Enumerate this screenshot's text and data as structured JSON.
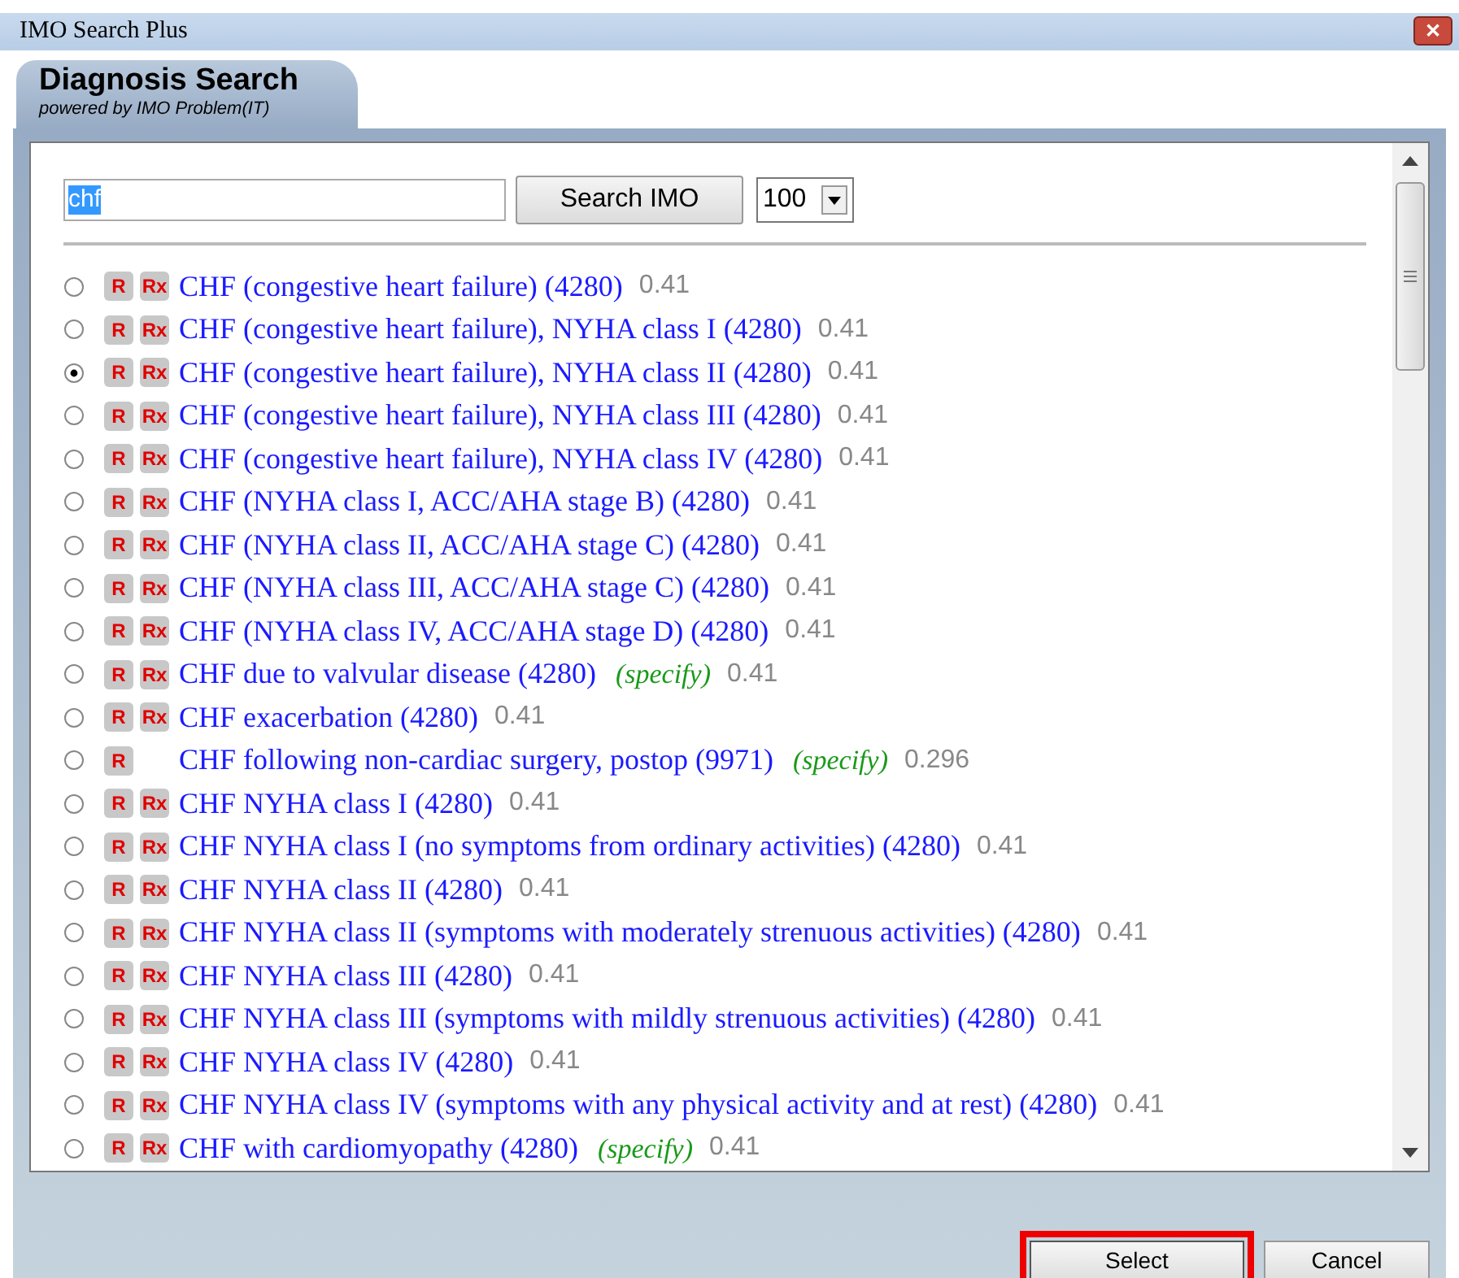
{
  "window": {
    "title": "IMO Search Plus",
    "close": "✕"
  },
  "header": {
    "title": "Diagnosis Search",
    "subtitle": "powered by IMO Problem(IT)"
  },
  "search": {
    "value": "chf",
    "button": "Search IMO",
    "limit": "100"
  },
  "rows": [
    {
      "badges": [
        "R",
        "Rx"
      ],
      "text": "CHF (congestive heart failure) (4280)",
      "specify": "",
      "score": "0.41",
      "selected": false
    },
    {
      "badges": [
        "R",
        "Rx"
      ],
      "text": "CHF (congestive heart failure), NYHA class I (4280)",
      "specify": "",
      "score": "0.41",
      "selected": false
    },
    {
      "badges": [
        "R",
        "Rx"
      ],
      "text": "CHF (congestive heart failure), NYHA class II (4280)",
      "specify": "",
      "score": "0.41",
      "selected": true
    },
    {
      "badges": [
        "R",
        "Rx"
      ],
      "text": "CHF (congestive heart failure), NYHA class III (4280)",
      "specify": "",
      "score": "0.41",
      "selected": false
    },
    {
      "badges": [
        "R",
        "Rx"
      ],
      "text": "CHF (congestive heart failure), NYHA class IV (4280)",
      "specify": "",
      "score": "0.41",
      "selected": false
    },
    {
      "badges": [
        "R",
        "Rx"
      ],
      "text": "CHF (NYHA class I, ACC/AHA stage B) (4280)",
      "specify": "",
      "score": "0.41",
      "selected": false
    },
    {
      "badges": [
        "R",
        "Rx"
      ],
      "text": "CHF (NYHA class II, ACC/AHA stage C) (4280)",
      "specify": "",
      "score": "0.41",
      "selected": false
    },
    {
      "badges": [
        "R",
        "Rx"
      ],
      "text": "CHF (NYHA class III, ACC/AHA stage C) (4280)",
      "specify": "",
      "score": "0.41",
      "selected": false
    },
    {
      "badges": [
        "R",
        "Rx"
      ],
      "text": "CHF (NYHA class IV, ACC/AHA stage D) (4280)",
      "specify": "",
      "score": "0.41",
      "selected": false
    },
    {
      "badges": [
        "R",
        "Rx"
      ],
      "text": "CHF due to valvular disease (4280)",
      "specify": "(specify)",
      "score": "0.41",
      "selected": false
    },
    {
      "badges": [
        "R",
        "Rx"
      ],
      "text": "CHF exacerbation (4280)",
      "specify": "",
      "score": "0.41",
      "selected": false
    },
    {
      "badges": [
        "R"
      ],
      "text": "CHF following non-cardiac surgery, postop (9971)",
      "specify": "(specify)",
      "score": "0.296",
      "selected": false
    },
    {
      "badges": [
        "R",
        "Rx"
      ],
      "text": "CHF NYHA class I (4280)",
      "specify": "",
      "score": "0.41",
      "selected": false
    },
    {
      "badges": [
        "R",
        "Rx"
      ],
      "text": "CHF NYHA class I (no symptoms from ordinary activities) (4280)",
      "specify": "",
      "score": "0.41",
      "selected": false
    },
    {
      "badges": [
        "R",
        "Rx"
      ],
      "text": "CHF NYHA class II (4280)",
      "specify": "",
      "score": "0.41",
      "selected": false
    },
    {
      "badges": [
        "R",
        "Rx"
      ],
      "text": "CHF NYHA class II (symptoms with moderately strenuous activities) (4280)",
      "specify": "",
      "score": "0.41",
      "selected": false
    },
    {
      "badges": [
        "R",
        "Rx"
      ],
      "text": "CHF NYHA class III (4280)",
      "specify": "",
      "score": "0.41",
      "selected": false
    },
    {
      "badges": [
        "R",
        "Rx"
      ],
      "text": "CHF NYHA class III (symptoms with mildly strenuous activities) (4280)",
      "specify": "",
      "score": "0.41",
      "selected": false
    },
    {
      "badges": [
        "R",
        "Rx"
      ],
      "text": "CHF NYHA class IV (4280)",
      "specify": "",
      "score": "0.41",
      "selected": false
    },
    {
      "badges": [
        "R",
        "Rx"
      ],
      "text": "CHF NYHA class IV (symptoms with any physical activity and at rest) (4280)",
      "specify": "",
      "score": "0.41",
      "selected": false
    },
    {
      "badges": [
        "R",
        "Rx"
      ],
      "text": "CHF with cardiomyopathy (4280)",
      "specify": "(specify)",
      "score": "0.41",
      "selected": false
    }
  ],
  "buttons": [
    {
      "label": "Select",
      "highlighted": true
    },
    {
      "label": "Cancel",
      "highlighted": false
    }
  ]
}
